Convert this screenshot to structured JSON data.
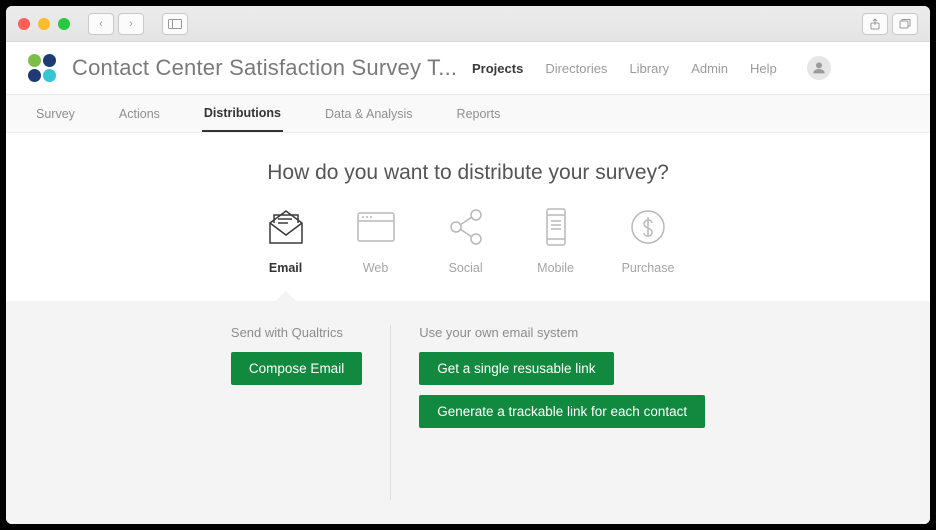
{
  "header": {
    "title": "Contact Center Satisfaction Survey T...",
    "nav": {
      "projects": "Projects",
      "directories": "Directories",
      "library": "Library",
      "admin": "Admin",
      "help": "Help"
    }
  },
  "tabs": {
    "survey": "Survey",
    "actions": "Actions",
    "distributions": "Distributions",
    "data_analysis": "Data & Analysis",
    "reports": "Reports"
  },
  "main": {
    "question": "How do you want to distribute your survey?",
    "options": {
      "email": "Email",
      "web": "Web",
      "social": "Social",
      "mobile": "Mobile",
      "purchase": "Purchase"
    },
    "panel": {
      "left_title": "Send with Qualtrics",
      "compose": "Compose Email",
      "right_title": "Use your own email system",
      "single_link": "Get a single resusable link",
      "trackable_link": "Generate a trackable link for each contact"
    }
  }
}
